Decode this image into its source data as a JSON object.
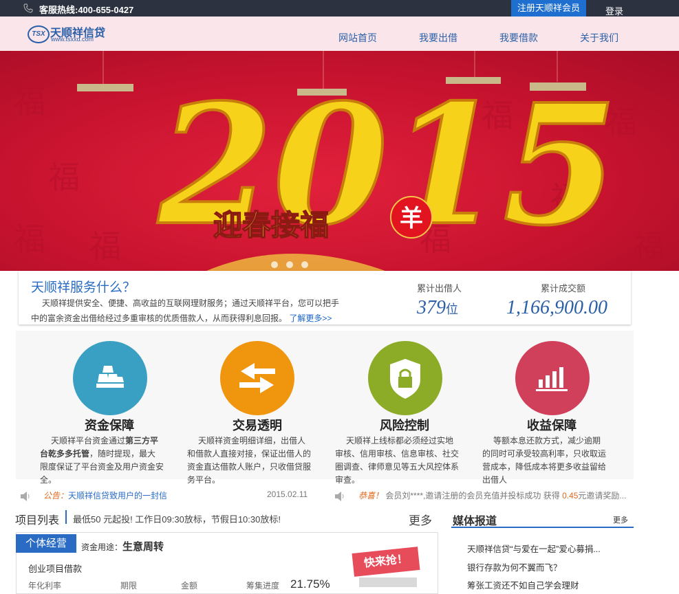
{
  "topbar": {
    "hotline": "客服热线:400-655-0427",
    "register": "注册天顺祥会员",
    "login": "登录"
  },
  "logo": {
    "badge": "TSX",
    "name": "天顺祥信贷",
    "url": "www.tsxxd.com"
  },
  "nav": {
    "items": [
      "网站首页",
      "我要出借",
      "我要借款",
      "关于我们"
    ]
  },
  "banner": {
    "year": "2015",
    "headline": "迎春接福",
    "seal": "羊"
  },
  "info": {
    "title": "天顺祥服务什么？",
    "text": "天顺祥提供安全、便捷、高收益的互联网理财服务；通过天顺祥平台，您可以把手中的富余资金出借给经过多重审核的优质借款人，从而获得利息回报。",
    "more": "了解更多>>",
    "lenders_label": "累计出借人",
    "lenders_value": "379",
    "lenders_unit": "位",
    "volume_label": "累计成交额",
    "volume_value": "1,166,900.00"
  },
  "features": [
    {
      "title": "资金保障",
      "text_a": "天顺祥平台资金通过",
      "text_b": "第三方平台乾多多托管",
      "text_c": "，随时提现，最大限度保证了平台资金及用户资金安全。",
      "color": "#3aa0c3",
      "icon": "gold-bars-icon"
    },
    {
      "title": "交易透明",
      "text": "天顺祥资金明细详细，出借人和借款人直接对接，保证出借人的资金直达借款人账户，只收借贷服务平台。",
      "color": "#f0960e",
      "icon": "exchange-icon"
    },
    {
      "title": "风险控制",
      "text": "天顺祥上线标都必须经过实地审核、信用审核、信息审核、社交圈调查、律师意见等五大风控体系审查。",
      "color": "#8cac28",
      "icon": "shield-lock-icon"
    },
    {
      "title": "收益保障",
      "text": "等额本息还款方式，减少逾期的同时可承受较高利率，只收取运营成本，降低成本将更多收益留给出借人",
      "color": "#d1405a",
      "icon": "bar-chart-icon"
    }
  ],
  "notices": {
    "left_label": "公告：",
    "left_text": "天顺祥信贷致用户的一封信",
    "left_date": "2015.02.11",
    "right_label": "恭喜！",
    "right_text_a": "会员刘****,邀请注册的会员充值并投标成功 获得",
    "right_amount": "0.45",
    "right_text_b": "元邀请奖励..."
  },
  "projects": {
    "title": "项目列表",
    "subtitle": "最低50 元起投! 工作日09:30放标，节假日10:30放标!",
    "more": "更多",
    "tag": "个体经营",
    "usage_label": "资金用途：",
    "usage_value": "生意周转",
    "item_name": "创业项目借款",
    "cols": [
      "年化利率",
      "期限",
      "金额",
      "筹集进度"
    ],
    "progress": "21.75%",
    "badge": "快来抢！"
  },
  "media": {
    "title": "媒体报道",
    "more": "更多",
    "items": [
      "天顺祥信贷“与爱在一起”爱心募捐...",
      "银行存款为何不翼而飞？",
      "筹张工资还不如自己学会理财"
    ]
  }
}
